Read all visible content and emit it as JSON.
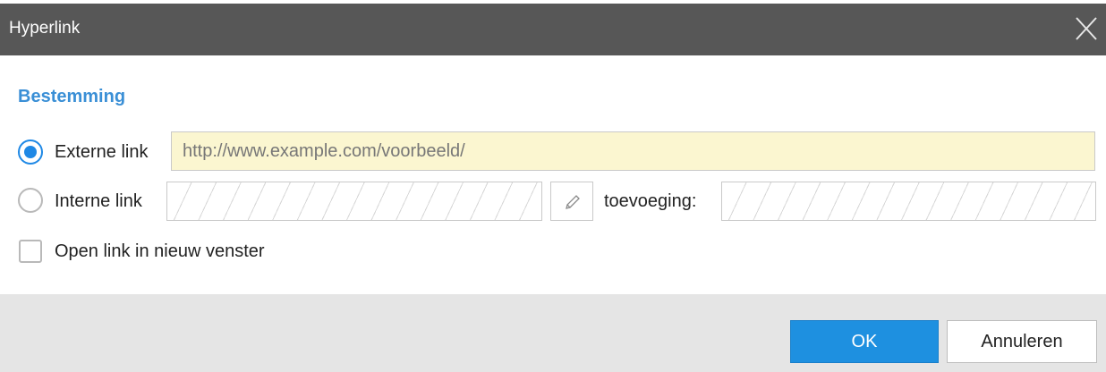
{
  "dialog": {
    "title": "Hyperlink",
    "close_icon": "close-icon"
  },
  "destination": {
    "heading": "Bestemming",
    "external": {
      "label": "Externe link",
      "selected": true,
      "value": "http://www.example.com/voorbeeld/"
    },
    "internal": {
      "label": "Interne link",
      "selected": false,
      "value": "",
      "edit_icon": "pencil-icon",
      "addition_label": "toevoeging:",
      "addition_value": ""
    },
    "new_window": {
      "label": "Open link in nieuw venster",
      "checked": false
    }
  },
  "footer": {
    "ok_label": "OK",
    "cancel_label": "Annuleren"
  },
  "colors": {
    "titlebar": "#575757",
    "accent": "#1e88e5",
    "heading": "#3a8fd6",
    "input_highlight": "#fbf6d0",
    "footer": "#e5e5e5"
  }
}
